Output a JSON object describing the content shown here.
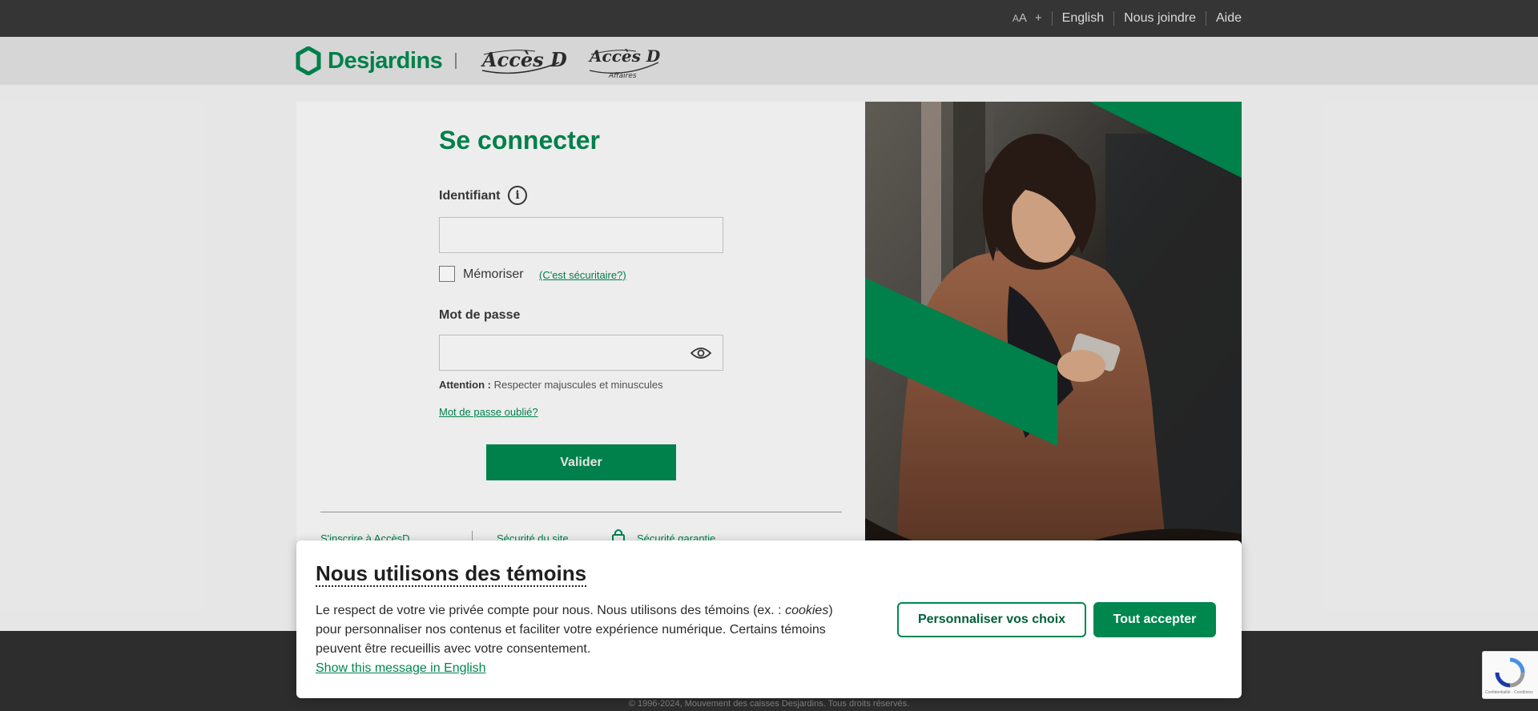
{
  "topbar": {
    "font_size_small": "A",
    "font_size_large": "A",
    "font_size_plus": "+",
    "links": [
      "English",
      "Nous joindre",
      "Aide"
    ]
  },
  "logos": {
    "desjardins": "Desjardins",
    "accesd": "Accès D",
    "accesd_affaires": "Accès D",
    "accesd_affaires_sub": "Affaires"
  },
  "login": {
    "title": "Se connecter",
    "identifier_label": "Identifiant",
    "identifier_value": "",
    "remember_label": "Mémoriser",
    "is_secure_link": "(C'est sécuritaire?)",
    "password_label": "Mot de passe",
    "password_value": "",
    "attention_label": "Attention :",
    "attention_text": " Respecter majuscules et minuscules",
    "forgot_link": "Mot de passe oublié?",
    "submit_label": "Valider"
  },
  "bottom_links": {
    "register": "S'inscrire à AccèsD",
    "site_security": "Sécurité du site",
    "guaranteed_security": "Sécurité garantie"
  },
  "cookie_banner": {
    "title": "Nous utilisons des témoins",
    "text_before": "Le respect de votre vie privée compte pour nous. Nous utilisons des témoins (ex. : ",
    "text_italic": "cookies",
    "text_after": ") pour personnaliser nos contenus et faciliter votre expérience numérique. Certains témoins peuvent être recueillis avec votre consentement.",
    "english_link": "Show this message in English",
    "customize_button": "Personnaliser vos choix",
    "accept_button": "Tout accepter"
  },
  "footer": {
    "copyright": "© 1996-2024, Mouvement des caisses Desjardins. Tous droits réservés."
  },
  "recaptcha": {
    "text": "Confidentialité - Conditions"
  },
  "colors": {
    "brand_green": "#00874e",
    "topbar": "#383838"
  }
}
